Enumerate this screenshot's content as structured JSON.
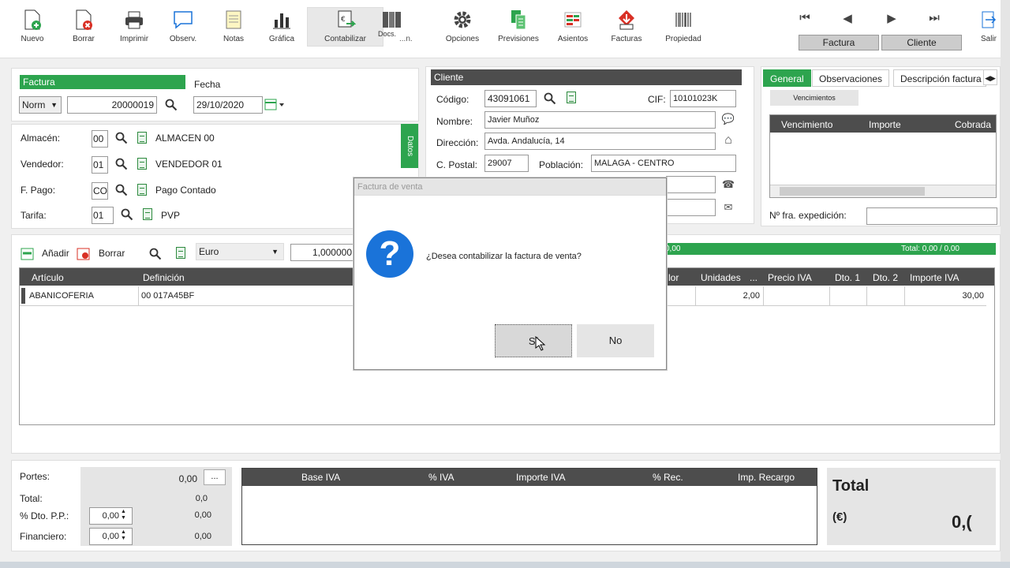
{
  "toolbar": {
    "buttons": [
      {
        "label": "Nuevo",
        "icon": "new-document-icon"
      },
      {
        "label": "Borrar",
        "icon": "delete-document-icon"
      },
      {
        "label": "Imprimir",
        "icon": "printer-icon"
      },
      {
        "label": "Observ.",
        "icon": "comment-icon"
      },
      {
        "label": "Notas",
        "icon": "notes-icon"
      },
      {
        "label": "Gráfica",
        "icon": "bar-chart-icon"
      },
      {
        "label": "Contabilizar",
        "icon": "accounting-icon"
      },
      {
        "label": "Docs.",
        "icon": "binders-icon"
      },
      {
        "label": "Opciones",
        "icon": "gear-icon"
      },
      {
        "label": "Previsiones",
        "icon": "forecast-icon"
      },
      {
        "label": "Asientos",
        "icon": "entries-icon"
      },
      {
        "label": "Facturas",
        "icon": "invoices-icon"
      },
      {
        "label": "Propiedad",
        "icon": "barcode-icon"
      },
      {
        "label": "Salir",
        "icon": "exit-icon"
      }
    ],
    "partial_label": "...n.",
    "nav_tabs": {
      "factura": "Factura",
      "cliente": "Cliente"
    }
  },
  "factura": {
    "header": "Factura",
    "fecha_label": "Fecha",
    "serie": "Norm",
    "number": "20000019",
    "date": "29/10/2020"
  },
  "datos_tab": "Datos",
  "fields": {
    "almacen": {
      "label": "Almacén:",
      "code": "00",
      "name": "ALMACEN 00"
    },
    "vendedor": {
      "label": "Vendedor:",
      "code": "01",
      "name": "VENDEDOR 01"
    },
    "fpago": {
      "label": "F. Pago:",
      "code": "CO",
      "name": "Pago Contado"
    },
    "tarifa": {
      "label": "Tarifa:",
      "code": "01",
      "name": "PVP"
    }
  },
  "cliente": {
    "header": "Cliente",
    "codigo_label": "Código:",
    "codigo": "43091061",
    "cif_label": "CIF:",
    "cif": "10101023K",
    "nombre_label": "Nombre:",
    "nombre": "Javier Muñoz",
    "direccion_label": "Dirección:",
    "direccion": "Avda. Andalucía, 14",
    "cpostal_label": "C. Postal:",
    "cpostal": "29007",
    "poblacion_label": "Población:",
    "poblacion": "MALAGA - CENTRO"
  },
  "right_tabs": {
    "tabs": [
      "General",
      "Observaciones",
      "Descripción factura"
    ],
    "vencimientos_button": "Vencimientos",
    "columns": [
      "Vencimiento",
      "Importe",
      "Cobrada"
    ],
    "nfra_label": "Nº fra. expedición:"
  },
  "lines": {
    "add_label": "Añadir",
    "delete_label": "Borrar",
    "currency": "Euro",
    "rate": "1,000000",
    "progress_left": "0,00",
    "total_text": "Total: 0,00 / 0,00",
    "columns_left": [
      "Artículo",
      "Definición"
    ],
    "columns_right": [
      "lor",
      "Unidades",
      "...",
      "Precio IVA",
      "Dto. 1",
      "Dto. 2",
      "Importe IVA"
    ],
    "rows": [
      {
        "articulo": "ABANICOFERIA",
        "definicion": "00 017A45BF",
        "unidades": "2,00",
        "importe": "30,00"
      }
    ]
  },
  "dialog": {
    "title": "Factura de venta",
    "message": "¿Desea contabilizar la factura de venta?",
    "yes": "Sí",
    "no": "No"
  },
  "summary": {
    "portes_label": "Portes:",
    "portes": "0,00",
    "ellipsis": "...",
    "total_label": "Total:",
    "total": "0,0",
    "dto_label": "% Dto. P.P.:",
    "dto_input": "0,00",
    "dto_value": "0,00",
    "financiero_label": "Financiero:",
    "financiero_input": "0,00",
    "financiero_value": "0,00",
    "iva_columns": [
      "Base IVA",
      "% IVA",
      "Importe IVA",
      "% Rec.",
      "Imp. Recargo"
    ],
    "grand_total_label": "Total",
    "currency_symbol": "(€)",
    "grand_total": "0,("
  },
  "colors": {
    "accent_green": "#2da44e",
    "header_dark": "#4d4d4d",
    "help_blue": "#1a73d9"
  }
}
